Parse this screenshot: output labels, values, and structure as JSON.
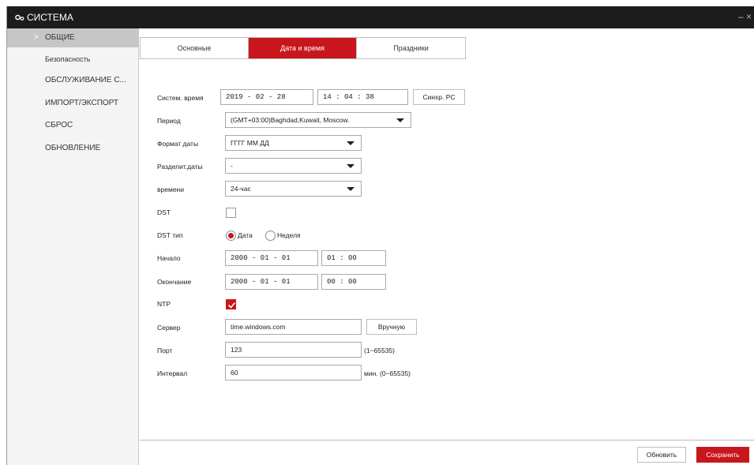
{
  "window": {
    "title": "СИСТЕМА",
    "minimize_glyph": "–",
    "close_glyph": "×",
    "logo_icon": "gears-icon"
  },
  "sidebar": {
    "items": [
      {
        "label": "ОБЩИЕ",
        "active": true
      },
      {
        "label": "Безопасность",
        "active": false
      },
      {
        "label": "ОБСЛУЖИВАНИЕ С...",
        "active": false
      },
      {
        "label": "ИМПОРТ/ЭКСПОРТ",
        "active": false
      },
      {
        "label": "СБРОС",
        "active": false
      },
      {
        "label": "ОБНОВЛЕНИЕ",
        "active": false
      }
    ],
    "active_chevron": ">"
  },
  "tabs": [
    {
      "label": "Основные",
      "active": false
    },
    {
      "label": "Дата и время",
      "active": true
    },
    {
      "label": "Праздники",
      "active": false
    }
  ],
  "form": {
    "system_time": {
      "label": "Систем. время",
      "date": "2019  -   02   -   28",
      "time": "14   :   04   :   38",
      "sync_button": "Синхр. PC"
    },
    "timezone": {
      "label": "Период",
      "value": "(GMT+03:00)Baghdad,Kuwait,  Moscow."
    },
    "date_format": {
      "label": "Формат даты",
      "value": "ГГГГ ММ ДД"
    },
    "date_separator": {
      "label": "Разделит.даты",
      "value": "-"
    },
    "time_format": {
      "label": "времени",
      "value": "24-час"
    },
    "dst": {
      "label": "DST",
      "checked": false
    },
    "dst_type": {
      "label": "DST тип",
      "options": [
        "Дата",
        "Неделя"
      ],
      "selected": "Дата"
    },
    "start": {
      "label": "Начало",
      "date": "2000  -   01   -   01",
      "time": "01   :   00"
    },
    "end": {
      "label": "Окончание",
      "date": "2000  -   01   -   01",
      "time": "00   :   00"
    },
    "ntp": {
      "label": "NTP",
      "checked": true
    },
    "server": {
      "label": "Сервер",
      "value": "time.windows.com",
      "manual_button": "Вручную"
    },
    "port": {
      "label": "Порт",
      "value": "123",
      "hint": "(1~65535)"
    },
    "interval": {
      "label": "Интервал",
      "value": "60",
      "hint": "мин. (0~65535)"
    }
  },
  "footer": {
    "refresh_button": "Обновить",
    "save_button": "Сохранить"
  },
  "colors": {
    "accent": "#c8161d",
    "titlebar": "#1c1c1c",
    "sidebar": "#f4f4f4",
    "sidebar_active": "#c6c6c6"
  }
}
